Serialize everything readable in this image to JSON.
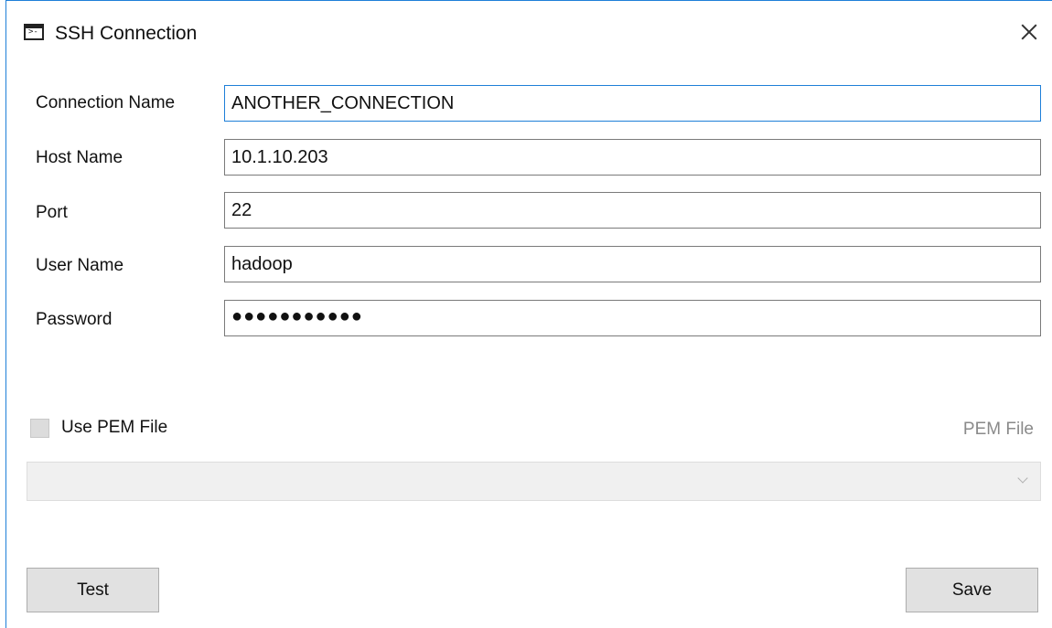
{
  "window": {
    "title": "SSH Connection",
    "icon": "terminal-icon",
    "icon_glyph": ">-"
  },
  "form": {
    "connection_name": {
      "label": "Connection Name",
      "value": "ANOTHER_CONNECTION"
    },
    "host_name": {
      "label": "Host Name",
      "value": "10.1.10.203"
    },
    "port": {
      "label": "Port",
      "value": "22"
    },
    "user_name": {
      "label": "User Name",
      "value": "hadoop"
    },
    "password": {
      "label": "Password",
      "value": "●●●●●●●●●●●"
    }
  },
  "pem": {
    "checkbox_label": "Use PEM File",
    "checked": false,
    "file_label": "PEM File",
    "selected": ""
  },
  "buttons": {
    "test": "Test",
    "save": "Save"
  },
  "colors": {
    "accent": "#1e7fd8",
    "button_bg": "#e1e1e1",
    "disabled_text": "#8a8a8a"
  }
}
